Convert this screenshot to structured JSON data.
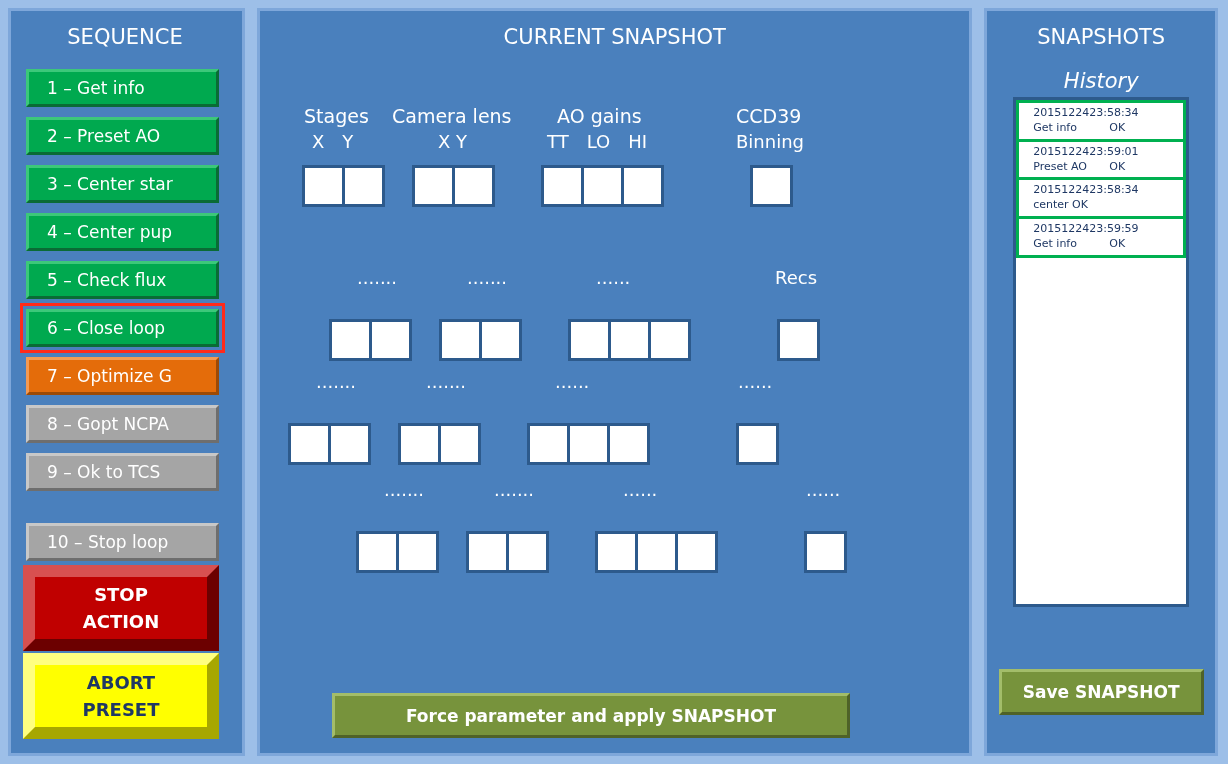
{
  "sequence": {
    "title": "SEQUENCE",
    "steps": [
      {
        "label": "1 – Get info",
        "kind": "done",
        "selected": false
      },
      {
        "label": "2 – Preset AO",
        "kind": "done",
        "selected": false
      },
      {
        "label": "3 – Center star",
        "kind": "done",
        "selected": false
      },
      {
        "label": "4 – Center pup",
        "kind": "done",
        "selected": false
      },
      {
        "label": "5 – Check flux",
        "kind": "done",
        "selected": false
      },
      {
        "label": "6 – Close loop",
        "kind": "done",
        "selected": true
      },
      {
        "label": "7 – Optimize G",
        "kind": "running",
        "selected": false
      },
      {
        "label": "8 – Gopt NCPA",
        "kind": "idle",
        "selected": false
      },
      {
        "label": "9 – Ok to TCS",
        "kind": "idle",
        "selected": false
      }
    ],
    "stop_step": {
      "label": "10 – Stop loop",
      "kind": "idle",
      "selected": false
    },
    "stop_action": "STOP ACTION",
    "abort_preset": "ABORT PRESET"
  },
  "snapshot": {
    "title": "CURRENT SNAPSHOT",
    "rows": [
      {
        "groups": [
          {
            "label": "Stages",
            "sublabels": [
              "X",
              "Y"
            ],
            "kind": "pair"
          },
          {
            "label": "Camera lens",
            "sublabels": [
              "X Y"
            ],
            "kind": "pair"
          },
          {
            "label": "AO gains",
            "sublabels": [
              "TT",
              "LO",
              "HI"
            ],
            "kind": "triple"
          },
          {
            "label": "CCD39",
            "sublabels": [
              "Binning"
            ],
            "kind": "single"
          }
        ]
      },
      {
        "groups": [
          {
            "label": ".......",
            "kind": "pair"
          },
          {
            "label": ".......",
            "kind": "pair"
          },
          {
            "label": "......",
            "kind": "triple"
          },
          {
            "label": "Recs",
            "kind": "single"
          }
        ]
      },
      {
        "groups": [
          {
            "label": ".......",
            "kind": "pair"
          },
          {
            "label": ".......",
            "kind": "pair"
          },
          {
            "label": "......",
            "kind": "triple"
          },
          {
            "label": "......",
            "kind": "single"
          }
        ]
      },
      {
        "groups": [
          {
            "label": ".......",
            "kind": "pair"
          },
          {
            "label": ".......",
            "kind": "pair"
          },
          {
            "label": "......",
            "kind": "triple"
          },
          {
            "label": "......",
            "kind": "single"
          }
        ]
      }
    ],
    "apply_button": "Force parameter and apply SNAPSHOT"
  },
  "snapshots": {
    "title": "SNAPSHOTS",
    "subtitle": "History",
    "entries": [
      {
        "timestamp": "2015122423:58:34",
        "action": "Get info",
        "result": "OK"
      },
      {
        "timestamp": "2015122423:59:01",
        "action": "Preset AO",
        "result": "OK"
      },
      {
        "timestamp": "2015122423:58:34",
        "action": "center OK"
      },
      {
        "timestamp": "2015122423:59:59",
        "action": "Get info",
        "result": "OK"
      }
    ],
    "save_button": "Save SNAPSHOT"
  }
}
